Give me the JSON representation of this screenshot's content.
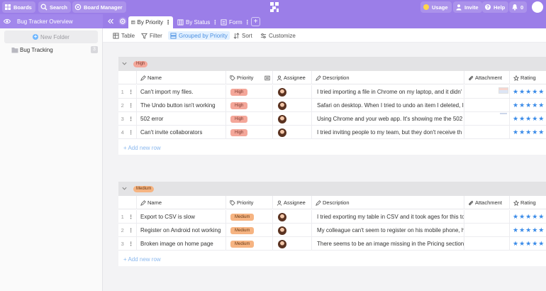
{
  "topbar": {
    "boards": "Boards",
    "search": "Search",
    "board_manager": "Board Manager",
    "usage": "Usage",
    "invite": "Invite",
    "help": "Help",
    "notifications_count": "0"
  },
  "viewbar": {
    "title": "Bug Tracker Overview",
    "tabs": [
      {
        "label": "By Priority"
      },
      {
        "label": "By Status"
      },
      {
        "label": "Form"
      }
    ],
    "add": "+"
  },
  "sidebar": {
    "new_folder": "New Folder",
    "folders": [
      {
        "name": "Bug Tracking",
        "count": "3"
      }
    ]
  },
  "toolbar": {
    "table": "Table",
    "filter": "Filter",
    "grouped": "Grouped by Priority",
    "sort": "Sort",
    "customize": "Customize"
  },
  "columns": {
    "name": "Name",
    "priority": "Priority",
    "assignee": "Assignee",
    "description": "Description",
    "attachment": "Attachment",
    "rating": "Rating"
  },
  "groups": [
    {
      "label": "High",
      "rows": [
        {
          "num": "1",
          "name": "Can't import my files.",
          "priority": "High",
          "description": "I tried importing a file in Chrome on my laptop, and it didn'",
          "rating": "★★★★★"
        },
        {
          "num": "2",
          "name": "The Undo button isn't working",
          "priority": "High",
          "description": "Safari on desktop. When I tried to undo an item I deleted, I",
          "rating": "★★★★★"
        },
        {
          "num": "3",
          "name": "502 error",
          "priority": "High",
          "description": "Using Chrome and your web app. It's showing me the 502",
          "rating": "★★★★★"
        },
        {
          "num": "4",
          "name": "Can't invite collaborators",
          "priority": "High",
          "description": "I tried inviting people to my team, but they don't receive th",
          "rating": "★★★★★"
        }
      ],
      "add_row": "+ Add new row"
    },
    {
      "label": "Medium",
      "rows": [
        {
          "num": "1",
          "name": "Export to CSV is slow",
          "priority": "Medium",
          "description": "I tried exporting my table in CSV and it took ages for this to",
          "rating": "★★★★★"
        },
        {
          "num": "2",
          "name": "Register on Android not working",
          "priority": "Medium",
          "description": "My colleague can't seem to register on his mobile phone, h",
          "rating": "★★★★★"
        },
        {
          "num": "3",
          "name": "Broken image on home page",
          "priority": "Medium",
          "description": "There seems to be an image missing in the Pricing section",
          "rating": "★★★★★"
        }
      ],
      "add_row": "+ Add new row"
    }
  ]
}
